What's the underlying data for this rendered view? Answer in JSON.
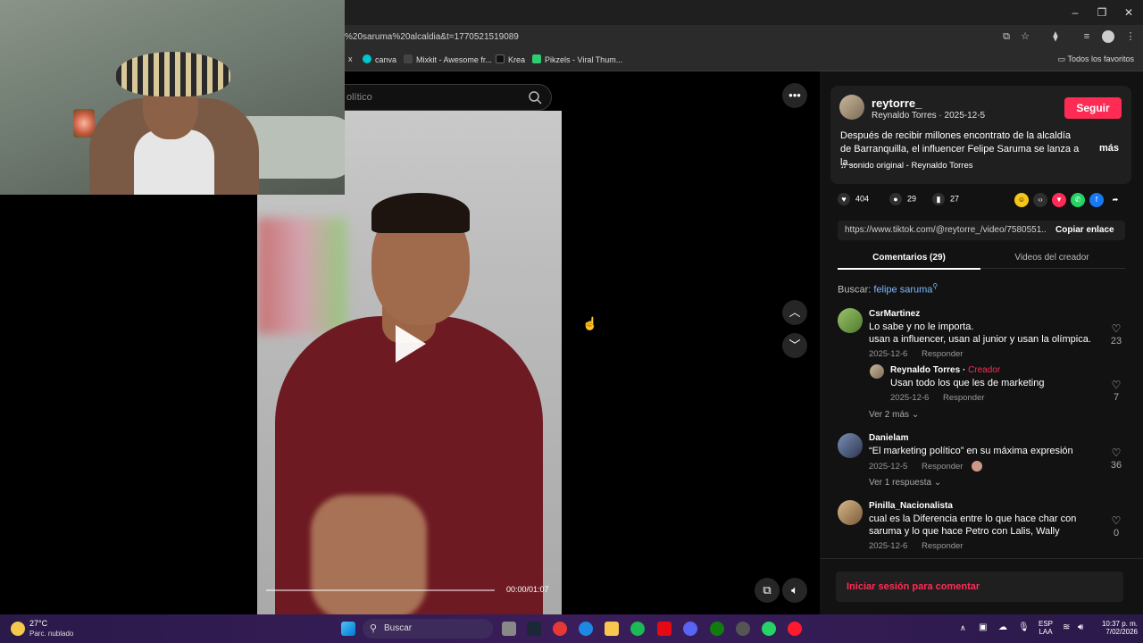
{
  "browser": {
    "url": "%20saruma%20alcaldia&t=1770521519089",
    "bookmarks": [
      {
        "label": "x",
        "color": "#666"
      },
      {
        "label": "canva",
        "color": "#00c4cc"
      },
      {
        "label": "Mixkit - Awesome fr...",
        "color": "#333"
      },
      {
        "label": "Krea",
        "color": "#222"
      },
      {
        "label": "Pikzels - Viral Thum...",
        "color": "#2ecc71"
      }
    ],
    "favorites": "Todos los favoritos"
  },
  "search": {
    "placeholder": "olítico"
  },
  "video": {
    "time": "00:00/01:07",
    "progress": 0
  },
  "post": {
    "username": "reytorre_",
    "subline": "Reynaldo Torres · 2025-12-5",
    "follow": "Seguir",
    "description": "Después de recibir millones encontrato de la alcaldía de Barranquilla, el influencer Felipe Saruma se lanza a la...",
    "more": "más",
    "sound": "sonido original - Reynaldo Torres",
    "likes": "404",
    "comments": "29",
    "saves": "27",
    "link": "https://www.tiktok.com/@reytorre_/video/7580551...",
    "copy": "Copiar enlace"
  },
  "tabs": {
    "comments": "Comentarios (29)",
    "creator_videos": "Videos del creador"
  },
  "search_row": {
    "label": "Buscar:",
    "keyword": "felipe saruma"
  },
  "comments": [
    {
      "user": "CsrMartinez",
      "line1": "Lo sabe y no le importa.",
      "line2": "usan a influencer, usan al junior y usan la olímpica.",
      "date": "2025-12-6",
      "reply": "Responder",
      "likes": "23"
    },
    {
      "user": "Reynaldo Torres",
      "tag": "Creador",
      "line1": "Usan todo los que les de marketing",
      "date": "2025-12-6",
      "reply": "Responder",
      "likes": "7"
    },
    {
      "user": "Danielam",
      "line1": "“El marketing político” en su máxima expresión",
      "date": "2025-12-5",
      "reply": "Responder",
      "likes": "36"
    },
    {
      "user": "Pinilla_Nacionalista",
      "line1": "cual es la Diferencia entre lo que hace char con",
      "line2": "saruma y lo que hace Petro con Lalis, Wally",
      "date": "2025-12-6",
      "reply": "Responder",
      "likes": "0"
    }
  ],
  "view_more_1": "Ver 2 más",
  "view_more_2": "Ver 1 respuesta",
  "login": "Iniciar sesión para comentar",
  "taskbar": {
    "temp": "27°C",
    "weather": "Parc. nublado",
    "search": "Buscar",
    "lang1": "ESP",
    "lang2": "LAA",
    "time": "10:37 p. m.",
    "date": "7/02/2026"
  }
}
